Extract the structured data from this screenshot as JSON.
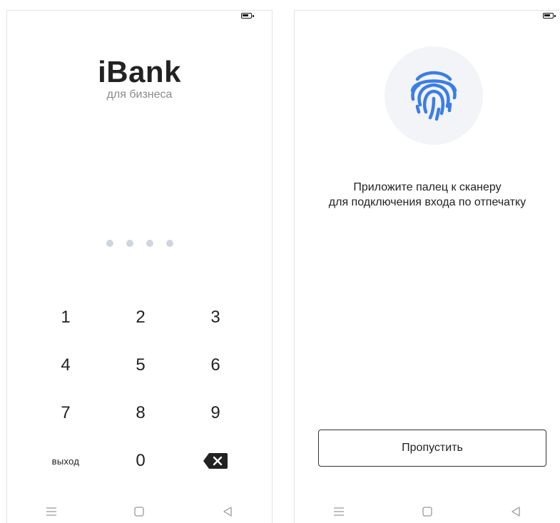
{
  "pin_screen": {
    "logo": "iBank",
    "logo_subtitle": "для бизнеса",
    "pin_dots_count": 4,
    "keypad": {
      "row1": [
        "1",
        "2",
        "3"
      ],
      "row2": [
        "4",
        "5",
        "6"
      ],
      "row3": [
        "7",
        "8",
        "9"
      ],
      "exit_label": "выход",
      "zero": "0",
      "backspace_icon": "backspace-icon"
    }
  },
  "fingerprint_screen": {
    "icon": "fingerprint-icon",
    "instruction_line1": "Приложите палец к сканеру",
    "instruction_line2": "для подключения входа по отпечатку",
    "skip_label": "Пропустить"
  },
  "system": {
    "nav_icons": [
      "menu-icon",
      "home-icon",
      "back-icon"
    ]
  },
  "colors": {
    "fingerprint": "#3b7de8",
    "pin_dot": "#cfd5e0",
    "circle_bg": "#f3f4f8"
  }
}
